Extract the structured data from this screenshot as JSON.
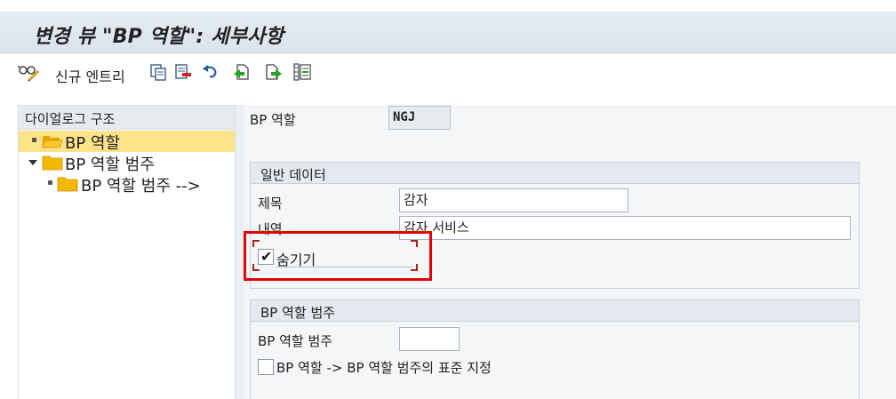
{
  "title": "변경 뷰 \"BP 역할\": 세부사항",
  "toolbar": {
    "new_entry_label": "신규 엔트리",
    "icons": [
      "glasses-pencil-icon",
      "copy-icon",
      "delete-icon",
      "undo-icon",
      "previous-entry-icon",
      "next-entry-icon",
      "select-all-icon"
    ]
  },
  "dialog_structure": {
    "header": "다이얼로그 구조",
    "items": [
      {
        "label": "BP 역할",
        "selected": true
      },
      {
        "label": "BP 역할 범주",
        "expanded": true
      },
      {
        "label": "BP 역할 범주 -->"
      }
    ]
  },
  "bp_role": {
    "label": "BP 역할",
    "value": "NGJ"
  },
  "general_data": {
    "header": "일반 데이터",
    "title_label": "제목",
    "title_value": "감자",
    "description_label": "내역",
    "description_value": "감자 서비스",
    "hide_label": "숨기기",
    "hide_checked": true
  },
  "role_category_group": {
    "header": "BP 역할 범주",
    "category_label": "BP 역할 범주",
    "category_value": "",
    "standard_assignment_label": "BP 역할 -> BP 역할 범주의 표준 지정",
    "standard_assignment_checked": false
  },
  "colors": {
    "highlight": "#e10000",
    "selected_row": "#fde28a",
    "folder": "#f5b800"
  }
}
